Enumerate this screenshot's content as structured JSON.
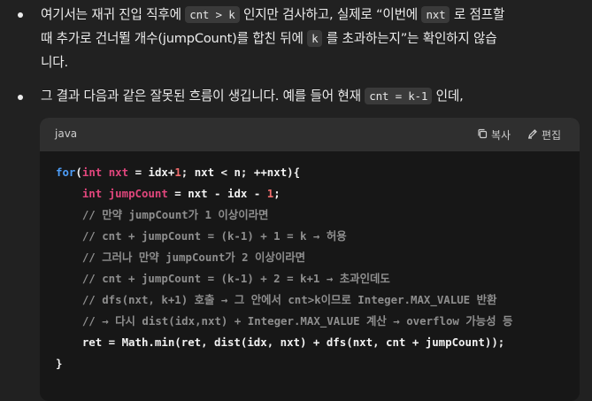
{
  "bullets": [
    {
      "lines": [
        [
          {
            "t": "여기서는 재귀 진입 직후에 ",
            "code": false
          },
          {
            "t": "cnt > k",
            "code": true
          },
          {
            "t": " 인지만 검사하고, 실제로 “이번에 ",
            "code": false
          },
          {
            "t": "nxt",
            "code": true
          },
          {
            "t": " 로 점프할",
            "code": false
          }
        ],
        [
          {
            "t": "때 추가로 건너뛸 개수(jumpCount)를 합친 뒤에 ",
            "code": false
          },
          {
            "t": "k",
            "code": true
          },
          {
            "t": " 를 초과하는지”는 확인하지 않습",
            "code": false
          }
        ],
        [
          {
            "t": "니다.",
            "code": false
          }
        ]
      ]
    },
    {
      "lines": [
        [
          {
            "t": "그 결과 다음과 같은 잘못된 흐름이 생깁니다. 예를 들어 현재 ",
            "code": false
          },
          {
            "t": "cnt = k-1",
            "code": true
          },
          {
            "t": " 인데,",
            "code": false
          }
        ]
      ]
    }
  ],
  "code_block": {
    "language": "java",
    "copy_label": "복사",
    "edit_label": "편집",
    "lines": [
      [
        [
          "kw",
          "for"
        ],
        [
          "plain",
          "("
        ],
        [
          "ty",
          "int"
        ],
        [
          "plain",
          " "
        ],
        [
          "id",
          "nxt"
        ],
        [
          "plain",
          " = idx+"
        ],
        [
          "num",
          "1"
        ],
        [
          "plain",
          "; nxt < n; ++nxt){"
        ]
      ],
      [
        [
          "plain",
          "    "
        ],
        [
          "ty",
          "int"
        ],
        [
          "plain",
          " "
        ],
        [
          "id",
          "jumpCount"
        ],
        [
          "plain",
          " = nxt - idx - "
        ],
        [
          "num",
          "1"
        ],
        [
          "plain",
          ";"
        ]
      ],
      [
        [
          "cm",
          "    // 만약 jumpCount가 1 이상이라면"
        ]
      ],
      [
        [
          "cm",
          "    // cnt + jumpCount = (k-1) + 1 = k → 허용"
        ]
      ],
      [
        [
          "cm",
          "    // 그러나 만약 jumpCount가 2 이상이라면"
        ]
      ],
      [
        [
          "cm",
          "    // cnt + jumpCount = (k-1) + 2 = k+1 → 초과인데도"
        ]
      ],
      [
        [
          "cm",
          "    // dfs(nxt, k+1) 호출 → 그 안에서 cnt>k이므로 Integer.MAX_VALUE 반환"
        ]
      ],
      [
        [
          "cm",
          "    // → 다시 dist(idx,nxt) + Integer.MAX_VALUE 계산 → overflow 가능성 등"
        ]
      ],
      [
        [
          "plain",
          "    ret = Math.min(ret, dist(idx, nxt) + dfs(nxt, cnt + jumpCount));"
        ]
      ],
      [
        [
          "plain",
          "}"
        ]
      ]
    ]
  },
  "colors": {
    "background": "#212121",
    "code_bg": "#171717",
    "code_header_bg": "#2f2f2f",
    "keyword": "#4d9df7",
    "type": "#e0467c",
    "number": "#ef6c6c",
    "comment": "#8e8e8e"
  },
  "icons": {
    "copy": "copy-icon",
    "edit": "edit-pencil-icon"
  }
}
